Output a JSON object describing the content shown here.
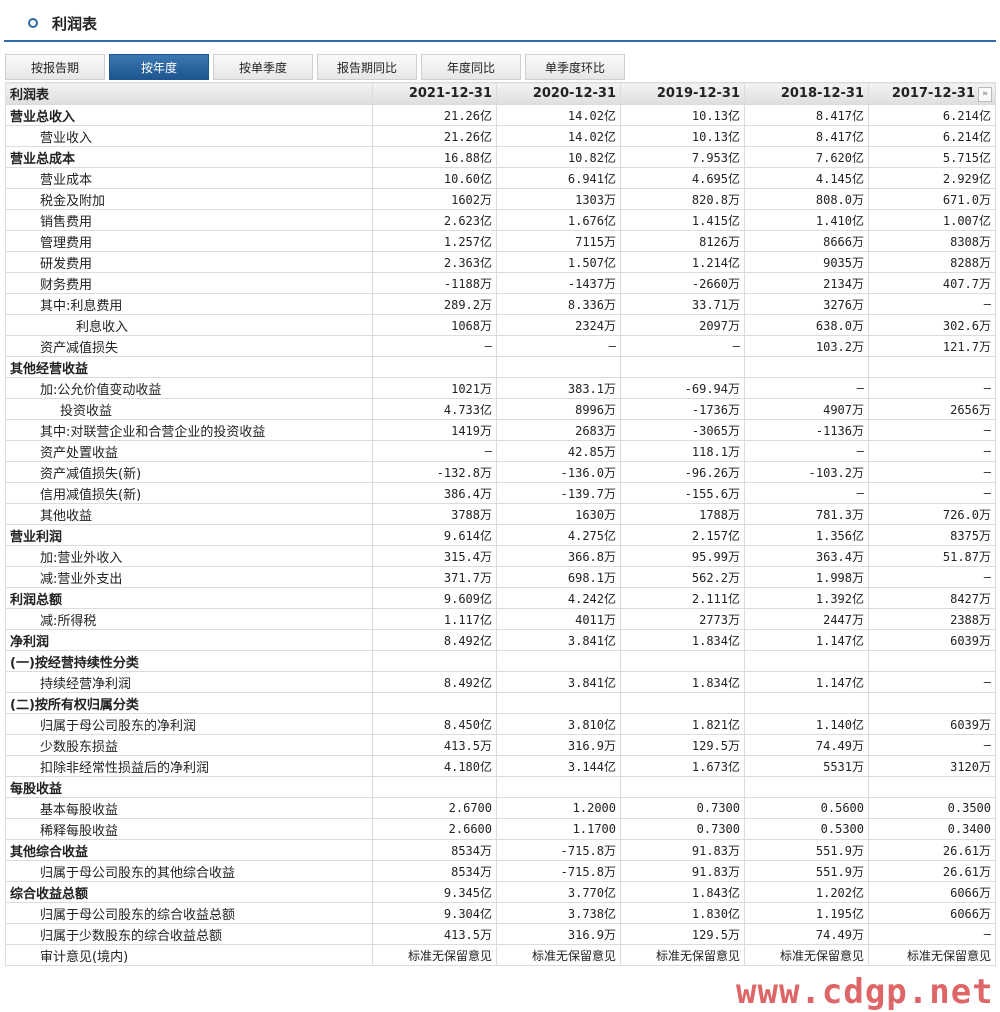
{
  "title": "利润表",
  "tabs": [
    {
      "label": "按报告期",
      "active": false
    },
    {
      "label": "按年度",
      "active": true
    },
    {
      "label": "按单季度",
      "active": false
    },
    {
      "label": "报告期同比",
      "active": false
    },
    {
      "label": "年度同比",
      "active": false
    },
    {
      "label": "单季度环比",
      "active": false
    }
  ],
  "table": {
    "header": [
      "利润表",
      "2021-12-31",
      "2020-12-31",
      "2019-12-31",
      "2018-12-31",
      "2017-12-31"
    ],
    "more_icon": "»",
    "rows": [
      {
        "label": "营业总收入",
        "indent": 0,
        "bold": true,
        "values": [
          "21.26亿",
          "14.02亿",
          "10.13亿",
          "8.417亿",
          "6.214亿"
        ]
      },
      {
        "label": "营业收入",
        "indent": 1,
        "bold": false,
        "values": [
          "21.26亿",
          "14.02亿",
          "10.13亿",
          "8.417亿",
          "6.214亿"
        ]
      },
      {
        "label": "营业总成本",
        "indent": 0,
        "bold": true,
        "values": [
          "16.88亿",
          "10.82亿",
          "7.953亿",
          "7.620亿",
          "5.715亿"
        ]
      },
      {
        "label": "营业成本",
        "indent": 1,
        "bold": false,
        "values": [
          "10.60亿",
          "6.941亿",
          "4.695亿",
          "4.145亿",
          "2.929亿"
        ]
      },
      {
        "label": "税金及附加",
        "indent": 1,
        "bold": false,
        "values": [
          "1602万",
          "1303万",
          "820.8万",
          "808.0万",
          "671.0万"
        ]
      },
      {
        "label": "销售费用",
        "indent": 1,
        "bold": false,
        "values": [
          "2.623亿",
          "1.676亿",
          "1.415亿",
          "1.410亿",
          "1.007亿"
        ]
      },
      {
        "label": "管理费用",
        "indent": 1,
        "bold": false,
        "values": [
          "1.257亿",
          "7115万",
          "8126万",
          "8666万",
          "8308万"
        ]
      },
      {
        "label": "研发费用",
        "indent": 1,
        "bold": false,
        "values": [
          "2.363亿",
          "1.507亿",
          "1.214亿",
          "9035万",
          "8288万"
        ]
      },
      {
        "label": "财务费用",
        "indent": 1,
        "bold": false,
        "values": [
          "-1188万",
          "-1437万",
          "-2660万",
          "2134万",
          "407.7万"
        ]
      },
      {
        "label": "其中:利息费用",
        "indent": 1,
        "bold": false,
        "values": [
          "289.2万",
          "8.336万",
          "33.71万",
          "3276万",
          "—"
        ]
      },
      {
        "label": "利息收入",
        "indent": 3,
        "bold": false,
        "values": [
          "1068万",
          "2324万",
          "2097万",
          "638.0万",
          "302.6万"
        ]
      },
      {
        "label": "资产减值损失",
        "indent": 1,
        "bold": false,
        "values": [
          "—",
          "—",
          "—",
          "103.2万",
          "121.7万"
        ]
      },
      {
        "label": "其他经营收益",
        "indent": 0,
        "bold": true,
        "values": [
          "",
          "",
          "",
          "",
          ""
        ]
      },
      {
        "label": "加:公允价值变动收益",
        "indent": 1,
        "bold": false,
        "values": [
          "1021万",
          "383.1万",
          "-69.94万",
          "—",
          "—"
        ]
      },
      {
        "label": "投资收益",
        "indent": 2,
        "bold": false,
        "values": [
          "4.733亿",
          "8996万",
          "-1736万",
          "4907万",
          "2656万"
        ]
      },
      {
        "label": "其中:对联营企业和合营企业的投资收益",
        "indent": 1,
        "bold": false,
        "values": [
          "1419万",
          "2683万",
          "-3065万",
          "-1136万",
          "—"
        ]
      },
      {
        "label": "资产处置收益",
        "indent": 1,
        "bold": false,
        "values": [
          "—",
          "42.85万",
          "118.1万",
          "—",
          "—"
        ]
      },
      {
        "label": "资产减值损失(新)",
        "indent": 1,
        "bold": false,
        "values": [
          "-132.8万",
          "-136.0万",
          "-96.26万",
          "-103.2万",
          "—"
        ]
      },
      {
        "label": "信用减值损失(新)",
        "indent": 1,
        "bold": false,
        "values": [
          "386.4万",
          "-139.7万",
          "-155.6万",
          "—",
          "—"
        ]
      },
      {
        "label": "其他收益",
        "indent": 1,
        "bold": false,
        "values": [
          "3788万",
          "1630万",
          "1788万",
          "781.3万",
          "726.0万"
        ]
      },
      {
        "label": "营业利润",
        "indent": 0,
        "bold": true,
        "values": [
          "9.614亿",
          "4.275亿",
          "2.157亿",
          "1.356亿",
          "8375万"
        ]
      },
      {
        "label": "加:营业外收入",
        "indent": 1,
        "bold": false,
        "values": [
          "315.4万",
          "366.8万",
          "95.99万",
          "363.4万",
          "51.87万"
        ]
      },
      {
        "label": "减:营业外支出",
        "indent": 1,
        "bold": false,
        "values": [
          "371.7万",
          "698.1万",
          "562.2万",
          "1.998万",
          "—"
        ]
      },
      {
        "label": "利润总额",
        "indent": 0,
        "bold": true,
        "values": [
          "9.609亿",
          "4.242亿",
          "2.111亿",
          "1.392亿",
          "8427万"
        ]
      },
      {
        "label": "减:所得税",
        "indent": 1,
        "bold": false,
        "values": [
          "1.117亿",
          "4011万",
          "2773万",
          "2447万",
          "2388万"
        ]
      },
      {
        "label": "净利润",
        "indent": 0,
        "bold": true,
        "values": [
          "8.492亿",
          "3.841亿",
          "1.834亿",
          "1.147亿",
          "6039万"
        ]
      },
      {
        "label": "(一)按经营持续性分类",
        "indent": 0,
        "bold": true,
        "values": [
          "",
          "",
          "",
          "",
          ""
        ]
      },
      {
        "label": "持续经营净利润",
        "indent": 1,
        "bold": false,
        "values": [
          "8.492亿",
          "3.841亿",
          "1.834亿",
          "1.147亿",
          "—"
        ]
      },
      {
        "label": "(二)按所有权归属分类",
        "indent": 0,
        "bold": true,
        "values": [
          "",
          "",
          "",
          "",
          ""
        ]
      },
      {
        "label": "归属于母公司股东的净利润",
        "indent": 1,
        "bold": false,
        "values": [
          "8.450亿",
          "3.810亿",
          "1.821亿",
          "1.140亿",
          "6039万"
        ]
      },
      {
        "label": "少数股东损益",
        "indent": 1,
        "bold": false,
        "values": [
          "413.5万",
          "316.9万",
          "129.5万",
          "74.49万",
          "—"
        ]
      },
      {
        "label": "扣除非经常性损益后的净利润",
        "indent": 1,
        "bold": false,
        "values": [
          "4.180亿",
          "3.144亿",
          "1.673亿",
          "5531万",
          "3120万"
        ]
      },
      {
        "label": "每股收益",
        "indent": 0,
        "bold": true,
        "values": [
          "",
          "",
          "",
          "",
          ""
        ]
      },
      {
        "label": "基本每股收益",
        "indent": 1,
        "bold": false,
        "values": [
          "2.6700",
          "1.2000",
          "0.7300",
          "0.5600",
          "0.3500"
        ]
      },
      {
        "label": "稀释每股收益",
        "indent": 1,
        "bold": false,
        "values": [
          "2.6600",
          "1.1700",
          "0.7300",
          "0.5300",
          "0.3400"
        ]
      },
      {
        "label": "其他综合收益",
        "indent": 0,
        "bold": true,
        "values": [
          "8534万",
          "-715.8万",
          "91.83万",
          "551.9万",
          "26.61万"
        ]
      },
      {
        "label": "归属于母公司股东的其他综合收益",
        "indent": 1,
        "bold": false,
        "values": [
          "8534万",
          "-715.8万",
          "91.83万",
          "551.9万",
          "26.61万"
        ]
      },
      {
        "label": "综合收益总额",
        "indent": 0,
        "bold": true,
        "values": [
          "9.345亿",
          "3.770亿",
          "1.843亿",
          "1.202亿",
          "6066万"
        ]
      },
      {
        "label": "归属于母公司股东的综合收益总额",
        "indent": 1,
        "bold": false,
        "values": [
          "9.304亿",
          "3.738亿",
          "1.830亿",
          "1.195亿",
          "6066万"
        ]
      },
      {
        "label": "归属于少数股东的综合收益总额",
        "indent": 1,
        "bold": false,
        "values": [
          "413.5万",
          "316.9万",
          "129.5万",
          "74.49万",
          "—"
        ]
      },
      {
        "label": "审计意见(境内)",
        "indent": 1,
        "bold": false,
        "values": [
          "标准无保留意见",
          "标准无保留意见",
          "标准无保留意见",
          "标准无保留意见",
          "标准无保留意见"
        ]
      }
    ]
  },
  "watermark": "www.cdgp.net"
}
